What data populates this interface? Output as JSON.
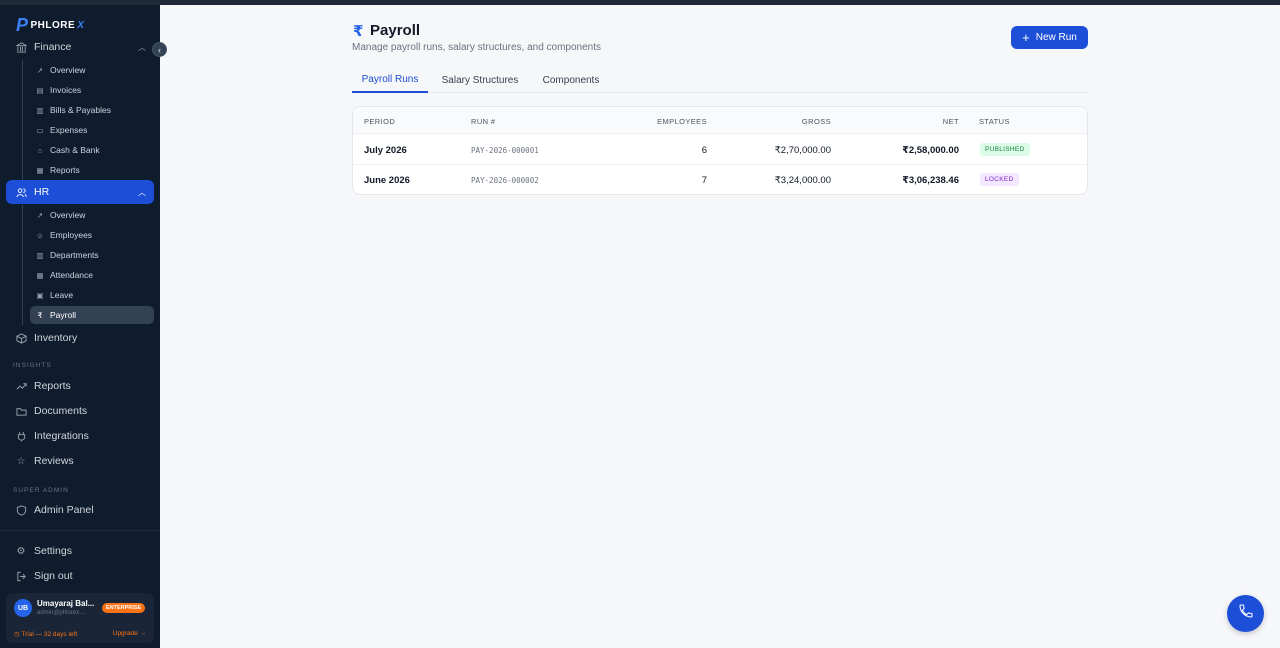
{
  "brand": {
    "name": "PHLORE",
    "suffix": "X"
  },
  "sidebar": {
    "finance": {
      "label": "Finance",
      "items": [
        {
          "label": "Overview",
          "icon": "trend-icon"
        },
        {
          "label": "Invoices",
          "icon": "file-icon"
        },
        {
          "label": "Bills & Payables",
          "icon": "receipt-icon"
        },
        {
          "label": "Expenses",
          "icon": "card-icon"
        },
        {
          "label": "Cash & Bank",
          "icon": "bank-icon"
        },
        {
          "label": "Reports",
          "icon": "bar-chart-icon"
        }
      ]
    },
    "hr": {
      "label": "HR",
      "items": [
        {
          "label": "Overview",
          "icon": "trend-icon"
        },
        {
          "label": "Employees",
          "icon": "users-icon"
        },
        {
          "label": "Departments",
          "icon": "building-icon"
        },
        {
          "label": "Attendance",
          "icon": "calendar-icon"
        },
        {
          "label": "Leave",
          "icon": "leave-icon"
        },
        {
          "label": "Payroll",
          "icon": "rupee-icon"
        }
      ]
    },
    "inventory": "Inventory",
    "insights_label": "INSIGHTS",
    "reports": "Reports",
    "documents": "Documents",
    "integrations": "Integrations",
    "reviews": "Reviews",
    "super_admin_label": "SUPER ADMIN",
    "admin_panel": "Admin Panel",
    "settings": "Settings",
    "sign_out": "Sign out"
  },
  "user": {
    "initials": "UB",
    "name": "Umayaraj Bal...",
    "email": "admin@phlorex....",
    "badge": "ENTERPRISE",
    "trial": "Trial — 32 days left",
    "upgrade": "Upgrade →"
  },
  "page": {
    "icon": "₹",
    "title": "Payroll",
    "subtitle": "Manage payroll runs, salary structures, and components",
    "new_run": "New Run"
  },
  "tabs": [
    "Payroll Runs",
    "Salary Structures",
    "Components"
  ],
  "table": {
    "headers": {
      "period": "PERIOD",
      "run": "RUN #",
      "employees": "EMPLOYEES",
      "gross": "GROSS",
      "net": "NET",
      "status": "STATUS"
    },
    "rows": [
      {
        "period": "July 2026",
        "run": "PAY-2026-000001",
        "employees": "6",
        "gross": "₹2,70,000.00",
        "net": "₹2,58,000.00",
        "status": "PUBLISHED"
      },
      {
        "period": "June 2026",
        "run": "PAY-2026-000002",
        "employees": "7",
        "gross": "₹3,24,000.00",
        "net": "₹3,06,238.46",
        "status": "LOCKED"
      }
    ]
  },
  "colors": {
    "sidebar_bg": "#0f1c2e",
    "accent": "#1d4ed8",
    "published": "#15803d",
    "locked": "#7e22ce",
    "enterprise": "#f97316"
  }
}
